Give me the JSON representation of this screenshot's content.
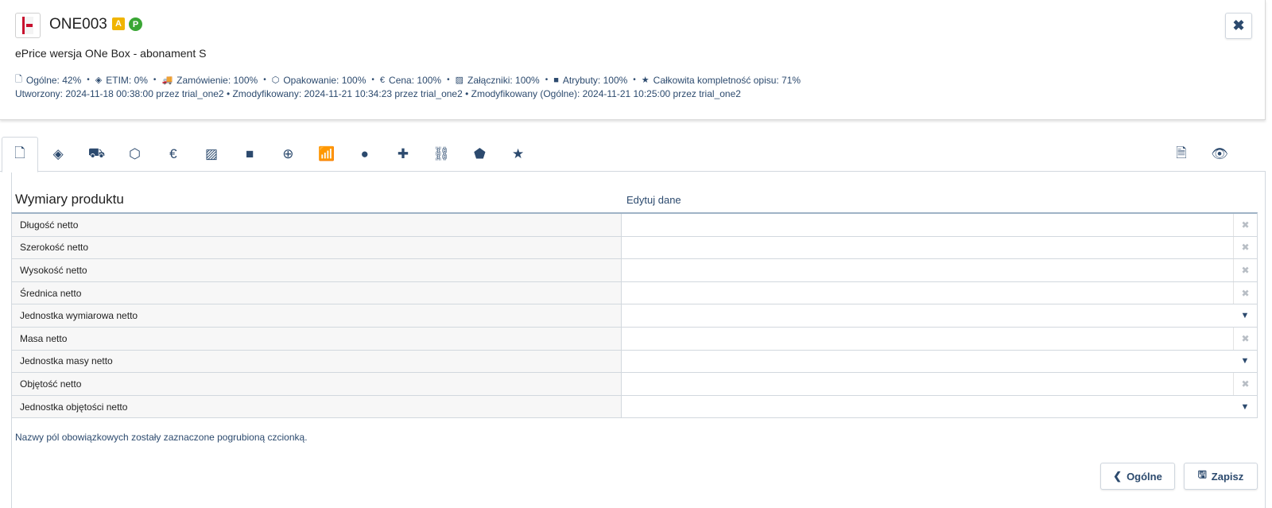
{
  "header": {
    "code": "ONE003",
    "badge_a": "A",
    "badge_p": "P",
    "product_name": "ePrice wersja ONe Box - abonament S",
    "stats": [
      {
        "icon": "file-icon",
        "glyph": "🗋",
        "text": "Ogólne: 42%"
      },
      {
        "icon": "etim-icon",
        "glyph": "◈",
        "text": "ETIM: 0%"
      },
      {
        "icon": "truck-icon",
        "glyph": "🚚",
        "text": "Zamówienie: 100%"
      },
      {
        "icon": "box-icon",
        "glyph": "⬡",
        "text": "Opakowanie: 100%"
      },
      {
        "icon": "euro-icon",
        "glyph": "€",
        "text": "Cena: 100%"
      },
      {
        "icon": "image-icon",
        "glyph": "▨",
        "text": "Załączniki: 100%"
      },
      {
        "icon": "note-icon",
        "glyph": "■",
        "text": "Atrybuty: 100%"
      },
      {
        "icon": "star-icon",
        "glyph": "★",
        "text": "Całkowita kompletność opisu: 71%"
      }
    ],
    "meta": "Utworzony: 2024-11-18 00:38:00 przez trial_one2  •  Zmodyfikowany: 2024-11-21 10:34:23 przez trial_one2  •  Zmodyfikowany (Ogólne): 2024-11-21 10:25:00 przez trial_one2",
    "close_glyph": "✖"
  },
  "tabs": [
    {
      "name": "tab-general",
      "icon": "file-icon",
      "glyph": "🗋"
    },
    {
      "name": "tab-etim",
      "icon": "etim-icon",
      "glyph": "◈"
    },
    {
      "name": "tab-order",
      "icon": "truck-icon",
      "glyph": "⛟"
    },
    {
      "name": "tab-packaging",
      "icon": "box-icon",
      "glyph": "⬡"
    },
    {
      "name": "tab-price",
      "icon": "euro-icon",
      "glyph": "€"
    },
    {
      "name": "tab-attachments",
      "icon": "image-icon",
      "glyph": "▨"
    },
    {
      "name": "tab-attributes",
      "icon": "note-icon",
      "glyph": "■"
    },
    {
      "name": "tab-add",
      "icon": "plus-circle-icon",
      "glyph": "⊕"
    },
    {
      "name": "tab-signal",
      "icon": "signal-icon",
      "glyph": "📶"
    },
    {
      "name": "tab-globe",
      "icon": "globe-icon",
      "glyph": "●"
    },
    {
      "name": "tab-puzzle",
      "icon": "puzzle-icon",
      "glyph": "✚"
    },
    {
      "name": "tab-hierarchy",
      "icon": "sitemap-icon",
      "glyph": "⛓"
    },
    {
      "name": "tab-tags",
      "icon": "tag-icon",
      "glyph": "⬟"
    },
    {
      "name": "tab-favorites",
      "icon": "star-icon",
      "glyph": "★"
    }
  ],
  "right_tabs": [
    {
      "name": "tab-document",
      "icon": "document-icon",
      "glyph": "🗎"
    },
    {
      "name": "tab-preview",
      "icon": "eye-icon",
      "glyph": "👁"
    }
  ],
  "section": {
    "title": "Wymiary produktu",
    "edit_label": "Edytuj dane"
  },
  "rows": [
    {
      "label": "Długość netto",
      "type": "clear"
    },
    {
      "label": "Szerokość netto",
      "type": "clear"
    },
    {
      "label": "Wysokość netto",
      "type": "clear"
    },
    {
      "label": "Średnica netto",
      "type": "clear"
    },
    {
      "label": "Jednostka wymiarowa netto",
      "type": "dropdown"
    },
    {
      "label": "Masa netto",
      "type": "clear"
    },
    {
      "label": "Jednostka masy netto",
      "type": "dropdown"
    },
    {
      "label": "Objętość netto",
      "type": "clear"
    },
    {
      "label": "Jednostka objętości netto",
      "type": "dropdown"
    }
  ],
  "footnote": "Nazwy pól obowiązkowych zostały zaznaczone pogrubioną czcionką.",
  "buttons": {
    "back_label": "Ogólne",
    "save_label": "Zapisz"
  }
}
